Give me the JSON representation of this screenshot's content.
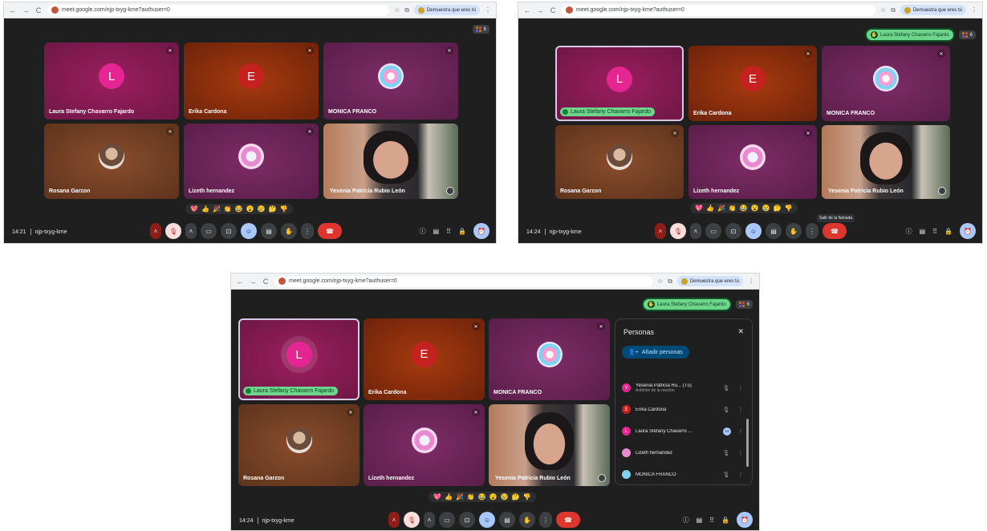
{
  "browser": {
    "url": "meet.google.com/njp-txyg-kme?authuser=0",
    "profile_label": "Demuestra que eres tú",
    "nav_back": "←",
    "nav_forward": "→",
    "nav_reload": "C"
  },
  "meeting": {
    "code": "njp-txyg-kme",
    "participant_count": "6"
  },
  "screenshots": [
    {
      "time": "14:21"
    },
    {
      "time": "14:24",
      "tooltip": "Salir de la llamada",
      "speaker_chip": "Laura Stefany Chavarro Fajardo"
    },
    {
      "time": "14:24",
      "speaker_chip": "Laura Stefany Chavarro Fajardo"
    }
  ],
  "tiles": [
    {
      "name": "Laura Stefany Chavarro Fajardo",
      "initial": "L"
    },
    {
      "name": "Erika Cardona",
      "initial": "E"
    },
    {
      "name": "MONICA FRANCO"
    },
    {
      "name": "Rosana Garzon"
    },
    {
      "name": "Lizeth hernandez"
    },
    {
      "name": "Yesenia Patricia Rubio León"
    }
  ],
  "reactions": [
    "💖",
    "👍",
    "🎉",
    "👏",
    "😂",
    "😮",
    "😢",
    "🤔",
    "👎"
  ],
  "panel": {
    "title": "Personas",
    "close": "✕",
    "add_label": "Añadir personas",
    "people": [
      {
        "name": "Yesenia Patricia Ru...",
        "you": "(Tú)",
        "role": "Anfitrión de la reunión",
        "initial": "Y",
        "color": "#e52592"
      },
      {
        "name": "Erika Cardona",
        "initial": "E",
        "color": "#c5221f"
      },
      {
        "name": "Laura Stefany Chavarro ...",
        "initial": "L",
        "color": "#e52592"
      },
      {
        "name": "Lizeth hernandez",
        "initial": "",
        "color": "#e98ad1"
      },
      {
        "name": "MONICA FRANCO",
        "initial": "",
        "color": "#7fd3f0"
      }
    ]
  },
  "icons": {
    "mic_off": "🎙",
    "camera": "▭",
    "present": "⊡",
    "emoji": "☺",
    "captions": "▤",
    "hand": "✋",
    "more": "⋮",
    "hangup": "☎",
    "info": "ⓘ",
    "chat": "▤",
    "activities": "⠿",
    "lock": "🔒",
    "chevron_up": "˄"
  }
}
